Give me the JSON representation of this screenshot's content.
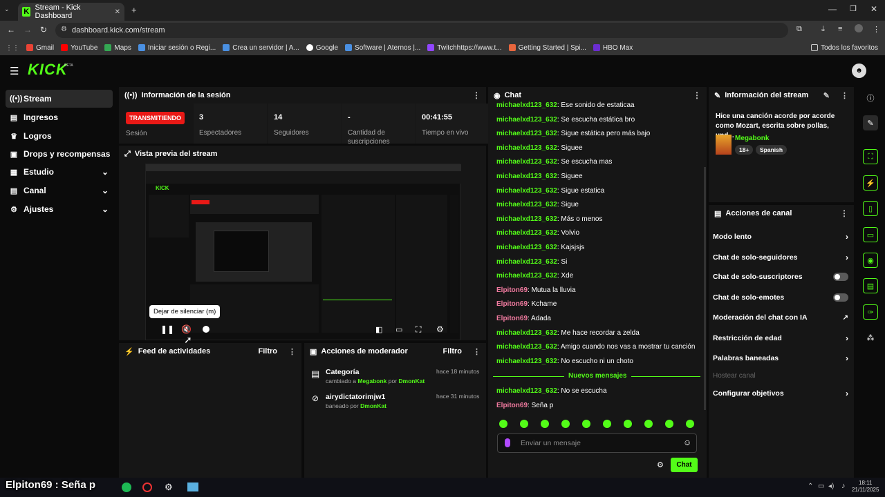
{
  "browser": {
    "tab_title": "Stream - Kick Dashboard",
    "url": "dashboard.kick.com/stream",
    "bookmarks": [
      "Gmail",
      "YouTube",
      "Maps",
      "Iniciar sesión o Regi...",
      "Crea un servidor | A...",
      "Google",
      "Software | Aternos |...",
      "Twitchhttps://www.t...",
      "Getting Started | Spi...",
      "HBO Max"
    ],
    "all_bookmarks": "Todos los favoritos"
  },
  "kick": {
    "logo": "KICK",
    "beta": "BETA"
  },
  "sidebar": {
    "items": [
      {
        "label": "Stream",
        "icon": "broadcast-icon"
      },
      {
        "label": "Ingresos",
        "icon": "chart-icon"
      },
      {
        "label": "Logros",
        "icon": "trophy-icon"
      },
      {
        "label": "Drops y recompensas",
        "icon": "gift-icon"
      },
      {
        "label": "Estudio",
        "icon": "studio-icon"
      },
      {
        "label": "Canal",
        "icon": "channel-icon"
      },
      {
        "label": "Ajustes",
        "icon": "gear-icon"
      }
    ]
  },
  "session": {
    "title": "Información de la sesión",
    "badge": "TRANSMITIENDO",
    "badge_label": "Sesión",
    "stats": [
      {
        "value": "3",
        "label": "Espectadores"
      },
      {
        "value": "14",
        "label": "Seguidores"
      },
      {
        "value": "-",
        "label": "Cantidad de suscripciones"
      },
      {
        "value": "00:41:55",
        "label": "Tiempo en vivo"
      }
    ]
  },
  "preview": {
    "title": "Vista previa del stream",
    "tooltip": "Dejar de silenciar (m)"
  },
  "activity": {
    "title": "Feed de actividades",
    "filter": "Filtro"
  },
  "moderator": {
    "title": "Acciones de moderador",
    "filter": "Filtro",
    "items": [
      {
        "title": "Categoría",
        "line": "cambiado a",
        "target": "Megabonk",
        "by": "por",
        "mod": "DmonKat",
        "time": "hace 18 minutos"
      },
      {
        "title": "airydictatorimjw1",
        "line": "baneado por",
        "target": "",
        "by": "",
        "mod": "DmonKat",
        "time": "hace 31 minutos"
      }
    ]
  },
  "chat": {
    "title": "Chat",
    "messages": [
      {
        "user": "michaelxd123_632",
        "text": "Ese sonido de estaticaa",
        "mod": true
      },
      {
        "user": "michaelxd123_632",
        "text": "Se escucha estática bro",
        "mod": true
      },
      {
        "user": "michaelxd123_632",
        "text": "Sigue estática pero más bajo",
        "mod": true
      },
      {
        "user": "michaelxd123_632",
        "text": "Siguee",
        "mod": true
      },
      {
        "user": "michaelxd123_632",
        "text": "Se escucha mas",
        "mod": true
      },
      {
        "user": "michaelxd123_632",
        "text": "Siguee",
        "mod": true
      },
      {
        "user": "michaelxd123_632",
        "text": "Sigue estatica",
        "mod": true
      },
      {
        "user": "michaelxd123_632",
        "text": "Sigue",
        "mod": true
      },
      {
        "user": "michaelxd123_632",
        "text": "Más o menos",
        "mod": true
      },
      {
        "user": "michaelxd123_632",
        "text": "Volvio",
        "mod": true
      },
      {
        "user": "michaelxd123_632",
        "text": "Kajsjsjs",
        "mod": true
      },
      {
        "user": "michaelxd123_632",
        "text": "Si",
        "mod": true
      },
      {
        "user": "michaelxd123_632",
        "text": "Xde",
        "mod": true
      },
      {
        "user": "Elpiton69",
        "text": "Mutua la lluvia",
        "mod": false
      },
      {
        "user": "Elpiton69",
        "text": "Kchame",
        "mod": false
      },
      {
        "user": "Elpiton69",
        "text": "Adada",
        "mod": false
      },
      {
        "user": "michaelxd123_632",
        "text": "Me hace recordar a zelda",
        "mod": true
      },
      {
        "user": "michaelxd123_632",
        "text": "Amigo cuando nos vas a mostrar tu canción",
        "mod": true
      },
      {
        "user": "michaelxd123_632",
        "text": "No escucho ni un choto",
        "mod": true
      }
    ],
    "new_label": "Nuevos mensajes",
    "new_messages": [
      {
        "user": "michaelxd123_632",
        "text": "No se escucha",
        "mod": true
      },
      {
        "user": "Elpiton69",
        "text": "Seña p",
        "mod": false
      }
    ],
    "placeholder": "Enviar un mensaje",
    "send": "Chat"
  },
  "stream_info": {
    "title": "Información del stream",
    "stream_title": "Hice una canción acorde por acorde como Mozart, escrita sobre pollas, und...",
    "category": "Megabonk",
    "tags": [
      "18+",
      "Spanish"
    ]
  },
  "channel_actions": {
    "title": "Acciones de canal",
    "items": [
      {
        "label": "Modo lento",
        "control": "chevron"
      },
      {
        "label": "Chat de solo-seguidores",
        "control": "chevron"
      },
      {
        "label": "Chat de solo-suscriptores",
        "control": "toggle"
      },
      {
        "label": "Chat de solo-emotes",
        "control": "toggle"
      },
      {
        "label": "Moderación del chat con IA",
        "control": "chart"
      },
      {
        "label": "Restricción de edad",
        "control": "chevron"
      },
      {
        "label": "Palabras baneadas",
        "control": "chevron"
      },
      {
        "label": "Hostear canal",
        "control": "disabled"
      },
      {
        "label": "Configurar objetivos",
        "control": "chevron"
      }
    ]
  },
  "overlay": {
    "caption": "Elpiton69 : Seña p"
  },
  "taskbar": {
    "time": "18:11",
    "date": "21/11/2025"
  },
  "colors": {
    "accent": "#53fc18",
    "live": "#e91916",
    "mod_user": "#53fc18",
    "user2": "#f27ba0"
  }
}
